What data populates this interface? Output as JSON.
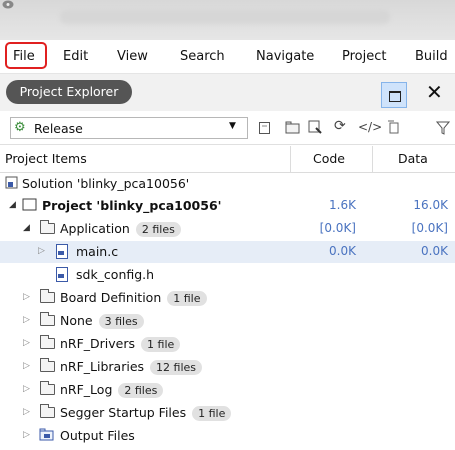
{
  "menubar": {
    "items": [
      "File",
      "Edit",
      "View",
      "Search",
      "Navigate",
      "Project",
      "Build"
    ]
  },
  "explorer": {
    "title": "Project Explorer",
    "close_glyph": "✕",
    "config_value": "Release",
    "columns": {
      "items": "Project Items",
      "code": "Code",
      "data": "Data"
    }
  },
  "tree": [
    {
      "label": "Solution 'blinky_pca10056'",
      "badge": "",
      "code": "",
      "data": "",
      "icon": "solution-icon",
      "expander": ""
    },
    {
      "label": "Project 'blinky_pca10056'",
      "badge": "",
      "code": "1.6K",
      "data": "16.0K",
      "icon": "project-icon",
      "expander": "expanded"
    },
    {
      "label": "Application",
      "badge": "2 files",
      "code": "[0.0K]",
      "data": "[0.0K]",
      "icon": "folder-icon",
      "expander": "expanded"
    },
    {
      "label": "main.c",
      "badge": "",
      "code": "0.0K",
      "data": "0.0K",
      "icon": "c-file-icon",
      "expander": "collapsed"
    },
    {
      "label": "sdk_config.h",
      "badge": "",
      "code": "",
      "data": "",
      "icon": "h-file-icon",
      "expander": ""
    },
    {
      "label": "Board Definition",
      "badge": "1 file",
      "code": "",
      "data": "",
      "icon": "folder-icon",
      "expander": "collapsed"
    },
    {
      "label": "None",
      "badge": "3 files",
      "code": "",
      "data": "",
      "icon": "folder-icon",
      "expander": "collapsed"
    },
    {
      "label": "nRF_Drivers",
      "badge": "1 file",
      "code": "",
      "data": "",
      "icon": "folder-icon",
      "expander": "collapsed"
    },
    {
      "label": "nRF_Libraries",
      "badge": "12 files",
      "code": "",
      "data": "",
      "icon": "folder-icon",
      "expander": "collapsed"
    },
    {
      "label": "nRF_Log",
      "badge": "2 files",
      "code": "",
      "data": "",
      "icon": "folder-icon",
      "expander": "collapsed"
    },
    {
      "label": "Segger Startup Files",
      "badge": "1 file",
      "code": "",
      "data": "",
      "icon": "folder-icon",
      "expander": "collapsed"
    },
    {
      "label": "Output Files",
      "badge": "",
      "code": "",
      "data": "",
      "icon": "output-folder-icon",
      "expander": "collapsed"
    }
  ],
  "colors": {
    "highlight_red": "#e02020",
    "value_blue": "#4a73c0",
    "selected_row": "#e6edf7"
  }
}
